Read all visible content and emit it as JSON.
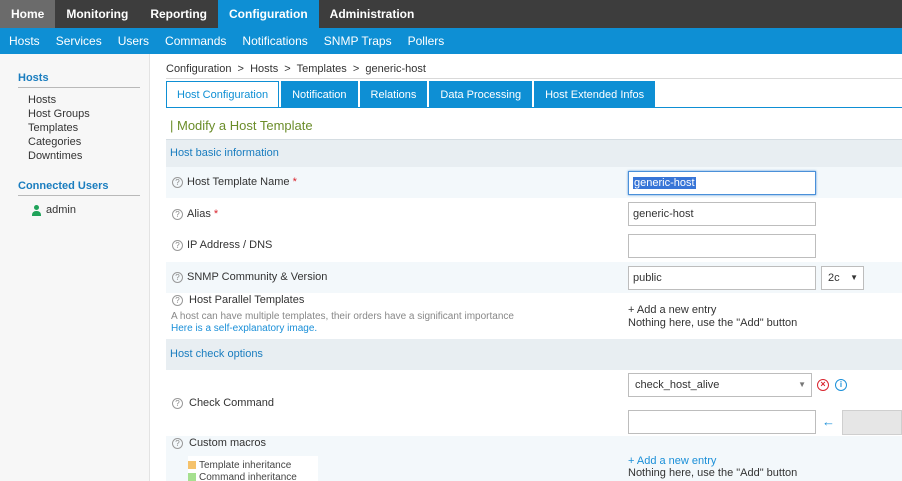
{
  "topnav": [
    "Home",
    "Monitoring",
    "Reporting",
    "Configuration",
    "Administration"
  ],
  "subnav": [
    "Hosts",
    "Services",
    "Users",
    "Commands",
    "Notifications",
    "SNMP Traps",
    "Pollers"
  ],
  "sidebar": {
    "hosts_title": "Hosts",
    "hosts_items": [
      "Hosts",
      "Host Groups",
      "Templates",
      "Categories",
      "Downtimes"
    ],
    "connected_title": "Connected Users",
    "user": "admin"
  },
  "breadcrumb": "Configuration  >  Hosts  >  Templates  >  generic-host",
  "tabs": [
    "Host Configuration",
    "Notification",
    "Relations",
    "Data Processing",
    "Host Extended Infos"
  ],
  "form_title": "| Modify a Host Template",
  "sections": {
    "basic": "Host basic information",
    "check": "Host check options"
  },
  "fields": {
    "template_name": {
      "label": "Host Template Name",
      "value": "generic-host"
    },
    "alias": {
      "label": "Alias",
      "value": "generic-host"
    },
    "ip": {
      "label": "IP Address / DNS",
      "value": ""
    },
    "snmp": {
      "label": "SNMP Community & Version",
      "value": "public",
      "version": "2c"
    },
    "parallel": {
      "label": "Host Parallel Templates",
      "desc": "A host can have multiple templates, their orders have a significant importance",
      "link": "Here is a self-explanatory image.",
      "add": "+ Add a new entry",
      "empty": "Nothing here, use the \"Add\" button"
    },
    "check_command": {
      "label": "Check Command",
      "value": "check_host_alive",
      "args": ""
    },
    "macros": {
      "label": "Custom macros",
      "add": "+ Add a new entry",
      "empty": "Nothing here, use the \"Add\" button",
      "legend": [
        "Template inheritance",
        "Command inheritance"
      ],
      "legend_colors": [
        "#f5c26b",
        "#a6e08f"
      ]
    }
  },
  "colors": {
    "accent": "#0e8fd4",
    "required": "#d9232d",
    "title_green": "#6b8d2a"
  }
}
